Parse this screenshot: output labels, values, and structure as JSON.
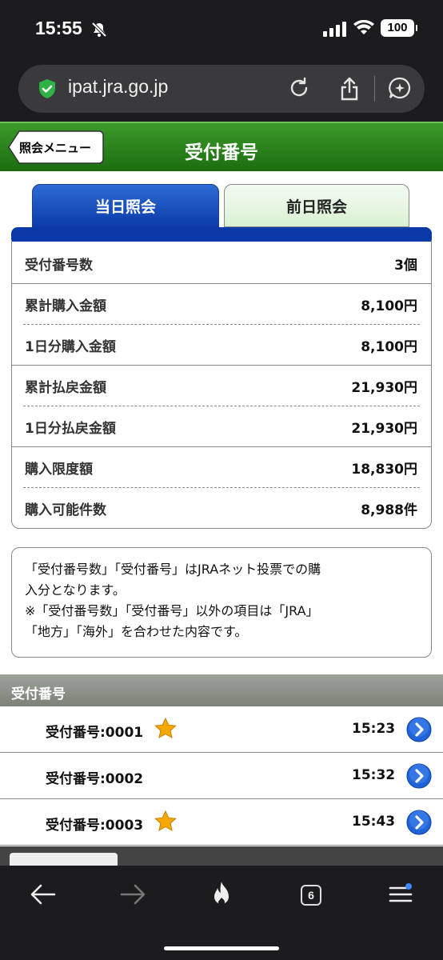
{
  "status_bar": {
    "time": "15:55",
    "battery": "100"
  },
  "browser": {
    "url": "ipat.jra.go.jp",
    "tab_count": "6"
  },
  "header": {
    "back_label": "照会メニュー",
    "title": "受付番号"
  },
  "tabs": [
    {
      "label": "当日照会",
      "active": true
    },
    {
      "label": "前日照会",
      "active": false
    }
  ],
  "summary": [
    {
      "label": "受付番号数",
      "value": "3個"
    },
    {
      "label": "累計購入金額",
      "value": "8,100円"
    },
    {
      "label": "1日分購入金額",
      "value": "8,100円"
    },
    {
      "label": "累計払戻金額",
      "value": "21,930円"
    },
    {
      "label": "1日分払戻金額",
      "value": "21,930円"
    },
    {
      "label": "購入限度額",
      "value": "18,830円"
    },
    {
      "label": "購入可能件数",
      "value": "8,988件"
    }
  ],
  "note": {
    "line1": "「受付番号数」「受付番号」はJRAネット投票での購",
    "line2": "入分となります。",
    "line3": "※「受付番号数」「受付番号」以外の項目は「JRA」",
    "line4": "「地方」「海外」を合わせた内容です。"
  },
  "receipts_header": "受付番号",
  "receipts": [
    {
      "label": "受付番号:0001",
      "time": "15:23",
      "star": true
    },
    {
      "label": "受付番号:0002",
      "time": "15:32",
      "star": false
    },
    {
      "label": "受付番号:0003",
      "time": "15:43",
      "star": true
    }
  ],
  "colors": {
    "header_green": "#1c6d10",
    "tab_blue": "#0a3aa8",
    "star": "#f5a800",
    "arrow_blue": "#1f63d8"
  }
}
